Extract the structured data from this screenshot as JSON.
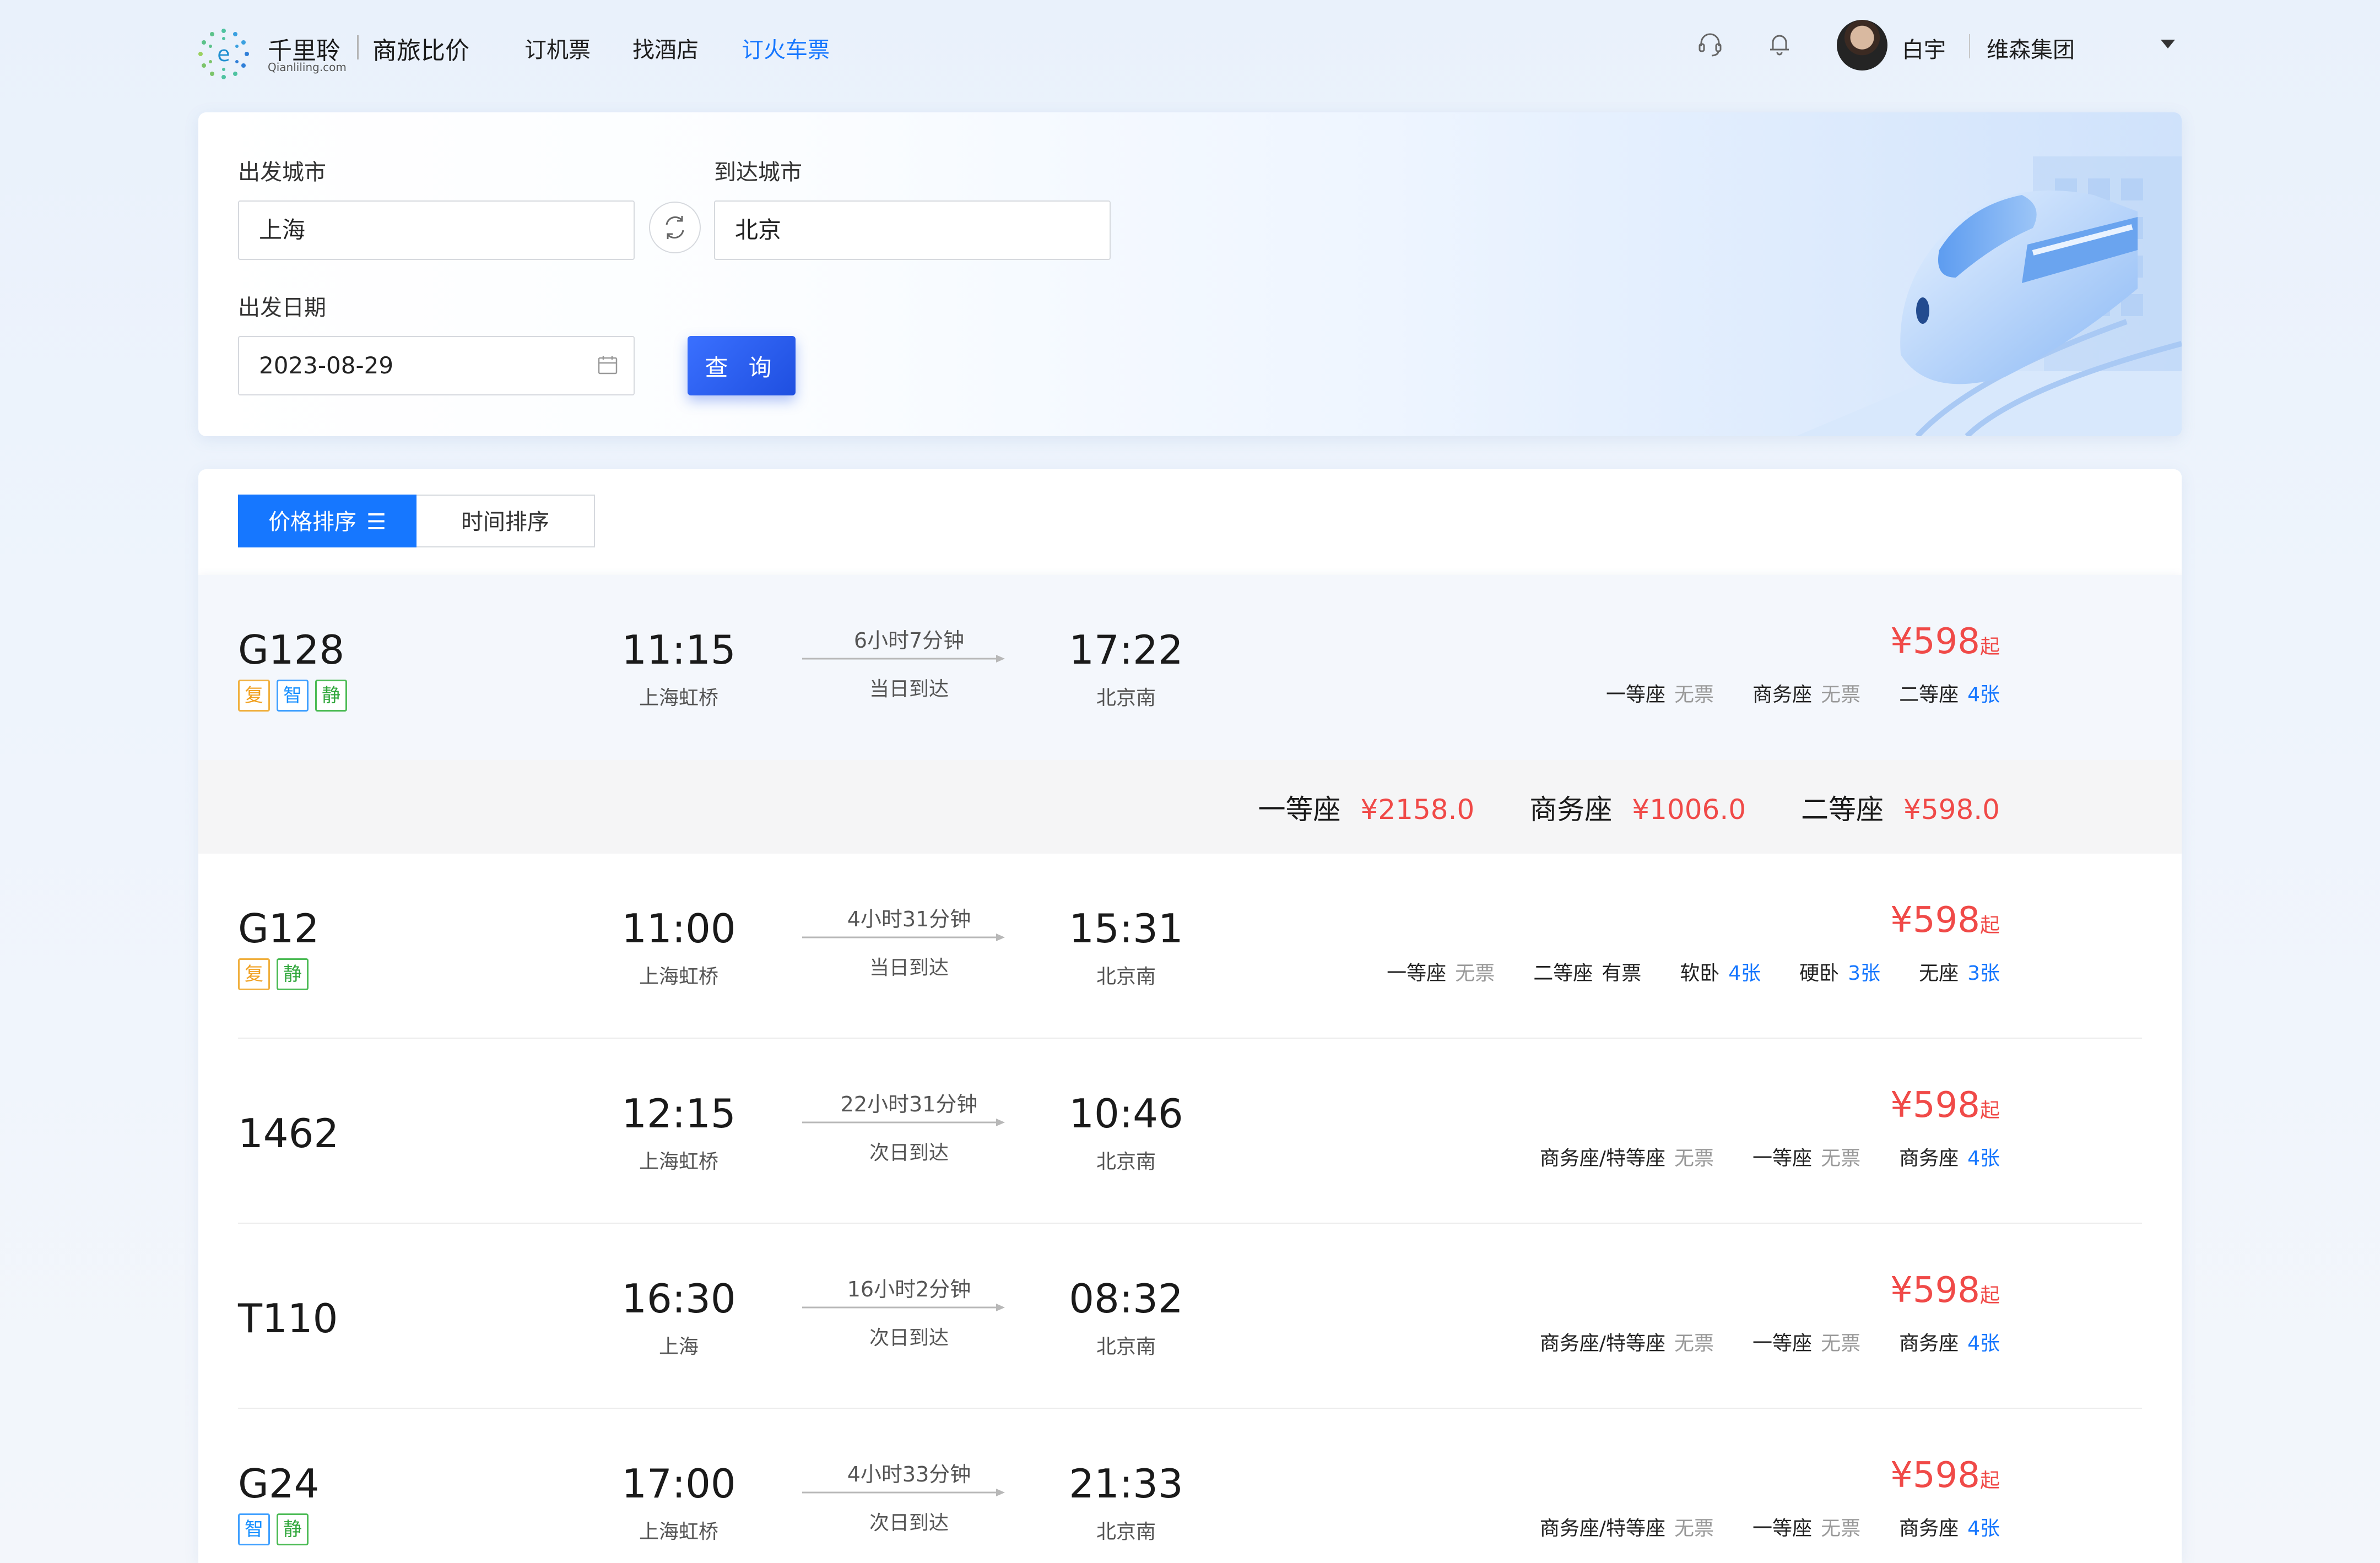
{
  "brand": {
    "name": "千里聆",
    "domain": "Qianliling.com",
    "slogan": "商旅比价"
  },
  "nav": [
    {
      "label": "订机票",
      "active": false
    },
    {
      "label": "找酒店",
      "active": false
    },
    {
      "label": "订火车票",
      "active": true
    }
  ],
  "user": {
    "name": "白宇",
    "company": "维森集团"
  },
  "search": {
    "from_label": "出发城市",
    "from_value": "上海",
    "to_label": "到达城市",
    "to_value": "北京",
    "date_label": "出发日期",
    "date_value": "2023-08-29",
    "query_label": "查 询"
  },
  "sort": {
    "price_label": "价格排序",
    "time_label": "时间排序",
    "active": "price"
  },
  "expanded_seats": [
    {
      "name": "一等座",
      "price": "¥2158.0"
    },
    {
      "name": "商务座",
      "price": "¥1006.0"
    },
    {
      "name": "二等座",
      "price": "¥598.0"
    }
  ],
  "trains": [
    {
      "no": "G128",
      "tags": [
        "复",
        "智",
        "静"
      ],
      "depart": "11:15",
      "from": "上海虹桥",
      "duration": "6小时7分钟",
      "arrive_note": "当日到达",
      "arrive": "17:22",
      "to": "北京南",
      "price": "¥598",
      "price_suffix": "起",
      "seats": [
        {
          "name": "一等座",
          "status": "无票"
        },
        {
          "name": "商务座",
          "status": "无票"
        },
        {
          "name": "二等座",
          "status": "4张"
        }
      ]
    },
    {
      "no": "G12",
      "tags": [
        "复",
        "静"
      ],
      "depart": "11:00",
      "from": "上海虹桥",
      "duration": "4小时31分钟",
      "arrive_note": "当日到达",
      "arrive": "15:31",
      "to": "北京南",
      "price": "¥598",
      "price_suffix": "起",
      "seats": [
        {
          "name": "一等座",
          "status": "无票"
        },
        {
          "name": "二等座",
          "status": "有票"
        },
        {
          "name": "软卧",
          "status": "4张"
        },
        {
          "name": "硬卧",
          "status": "3张"
        },
        {
          "name": "无座",
          "status": "3张"
        }
      ]
    },
    {
      "no": "1462",
      "tags": [],
      "depart": "12:15",
      "from": "上海虹桥",
      "duration": "22小时31分钟",
      "arrive_note": "次日到达",
      "arrive": "10:46",
      "to": "北京南",
      "price": "¥598",
      "price_suffix": "起",
      "seats": [
        {
          "name": "商务座/特等座",
          "status": "无票"
        },
        {
          "name": "一等座",
          "status": "无票"
        },
        {
          "name": "商务座",
          "status": "4张"
        }
      ]
    },
    {
      "no": "T110",
      "tags": [],
      "depart": "16:30",
      "from": "上海",
      "duration": "16小时2分钟",
      "arrive_note": "次日到达",
      "arrive": "08:32",
      "to": "北京南",
      "price": "¥598",
      "price_suffix": "起",
      "seats": [
        {
          "name": "商务座/特等座",
          "status": "无票"
        },
        {
          "name": "一等座",
          "status": "无票"
        },
        {
          "name": "商务座",
          "status": "4张"
        }
      ]
    },
    {
      "no": "G24",
      "tags": [
        "智",
        "静"
      ],
      "depart": "17:00",
      "from": "上海虹桥",
      "duration": "4小时33分钟",
      "arrive_note": "次日到达",
      "arrive": "21:33",
      "to": "北京南",
      "price": "¥598",
      "price_suffix": "起",
      "seats": [
        {
          "name": "商务座/特等座",
          "status": "无票"
        },
        {
          "name": "一等座",
          "status": "无票"
        },
        {
          "name": "商务座",
          "status": "4张"
        }
      ]
    }
  ]
}
